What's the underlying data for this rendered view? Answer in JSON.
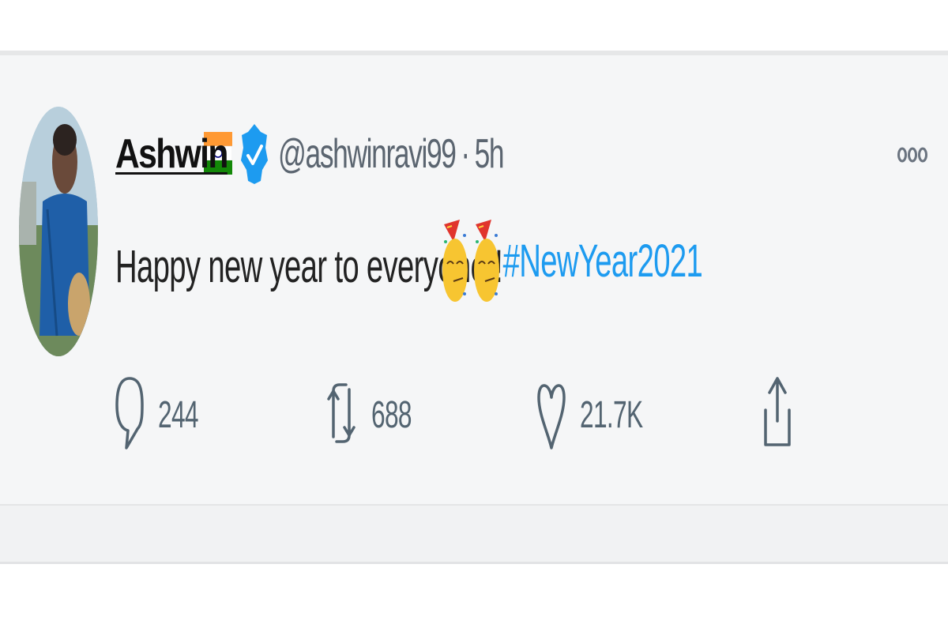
{
  "tweet": {
    "author": {
      "display_name": "Ashwin",
      "flag_icon": "india-flag-icon",
      "verified_icon": "verified-badge-icon",
      "handle": "@ashwinravi99",
      "separator": "·",
      "timestamp": "5h"
    },
    "body": {
      "text": "Happy new year to everyone!!",
      "emoji_icon": "partying-face-emoji",
      "hashtag": "#NewYear2021"
    },
    "more_icon": "more-options-icon",
    "actions": {
      "reply": {
        "icon": "reply-icon",
        "count": "244"
      },
      "retweet": {
        "icon": "retweet-icon",
        "count": "688"
      },
      "like": {
        "icon": "heart-icon",
        "count": "21.7K"
      },
      "share": {
        "icon": "share-icon"
      }
    }
  },
  "colors": {
    "hashtag": "#1d9bf0",
    "verified": "#1d9bf0",
    "icon_gray": "#536471",
    "card_bg": "#f5f6f7"
  }
}
